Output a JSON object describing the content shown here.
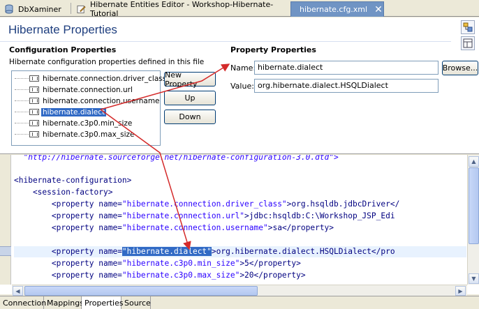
{
  "tabs": [
    {
      "label": "DbXaminer",
      "active": false
    },
    {
      "label": "Hibernate Entities Editor - Workshop-Hibernate-Tutorial",
      "active": false
    },
    {
      "label": "hibernate.cfg.xml",
      "active": true
    }
  ],
  "page_title": "Hibernate Properties",
  "config": {
    "heading": "Configuration Properties",
    "description": "Hibernate configuration properties defined in this file",
    "items": [
      {
        "label": "hibernate.connection.driver_class",
        "selected": false
      },
      {
        "label": "hibernate.connection.url",
        "selected": false
      },
      {
        "label": "hibernate.connection.username",
        "selected": false
      },
      {
        "label": "hibernate.dialect",
        "selected": true
      },
      {
        "label": "hibernate.c3p0.min_size",
        "selected": false
      },
      {
        "label": "hibernate.c3p0.max_size",
        "selected": false
      }
    ],
    "buttons": {
      "new": "New Property",
      "up": "Up",
      "down": "Down"
    }
  },
  "property": {
    "heading": "Property Properties",
    "name_label": "Name:",
    "name_value": "hibernate.dialect",
    "browse_label": "Browse...",
    "value_label": "Value:",
    "value_value": "org.hibernate.dialect.HSQLDialect"
  },
  "source": {
    "line0": "  \"http://hibernate.sourceforge.net/hibernate-configuration-3.0.dtd\">",
    "line1": "<hibernate-configuration>",
    "line2": "    <session-factory>",
    "lines": [
      {
        "pre": "        <property name=",
        "attr": "\"hibernate.connection.driver_class\"",
        "post": ">org.hsqldb.jdbcDriver</"
      },
      {
        "pre": "        <property name=",
        "attr": "\"hibernate.connection.url\"",
        "post": ">jdbc:hsqldb:C:\\Workshop_JSP_Edi"
      },
      {
        "pre": "        <property name=",
        "attr": "\"hibernate.connection.username\"",
        "post": ">sa</property>"
      },
      {
        "pre": "",
        "attr": "",
        "post": ""
      },
      {
        "pre": "        <property name=",
        "attr": "\"hibernate.dialect\"",
        "post": ">org.hibernate.dialect.HSQLDialect</pro"
      },
      {
        "pre": "        <property name=",
        "attr": "\"hibernate.c3p0.min_size\"",
        "post": ">5</property>"
      },
      {
        "pre": "        <property name=",
        "attr": "\"hibernate.c3p0.max_size\"",
        "post": ">20</property>"
      }
    ]
  },
  "bottom_tabs": [
    {
      "label": "Connection",
      "active": false
    },
    {
      "label": "Mappings",
      "active": false
    },
    {
      "label": "Properties",
      "active": true
    },
    {
      "label": "Source",
      "active": false
    }
  ],
  "icons": {
    "dbx": "database-icon",
    "entities": "edit-icon",
    "xml": "xml-file-icon",
    "property": "property-icon"
  },
  "colors": {
    "accent": "#316ac5",
    "active_tab": "#7094c4",
    "title": "#1f3f7f",
    "arrow": "#d42a2a"
  }
}
